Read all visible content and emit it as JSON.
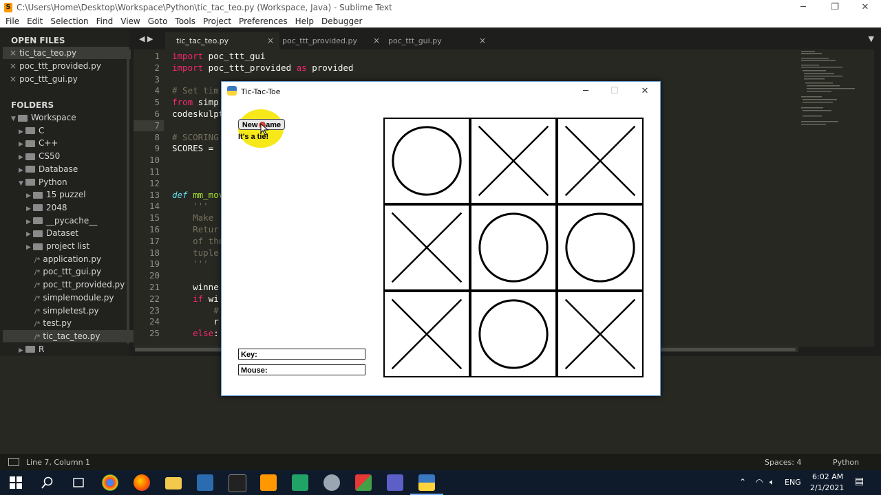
{
  "window": {
    "title": "C:\\Users\\Home\\Desktop\\Workspace\\Python\\tic_tac_teo.py (Workspace, Java) - Sublime Text"
  },
  "menu": [
    "File",
    "Edit",
    "Selection",
    "Find",
    "View",
    "Goto",
    "Tools",
    "Project",
    "Preferences",
    "Help",
    "Debugger"
  ],
  "sidebar": {
    "open_files_title": "OPEN FILES",
    "open_files": [
      "tic_tac_teo.py",
      "poc_ttt_provided.py",
      "poc_ttt_gui.py"
    ],
    "folders_title": "FOLDERS",
    "tree": [
      {
        "label": "Workspace",
        "depth": 0,
        "type": "folder-open"
      },
      {
        "label": "C",
        "depth": 1,
        "type": "folder"
      },
      {
        "label": "C++",
        "depth": 1,
        "type": "folder"
      },
      {
        "label": "CS50",
        "depth": 1,
        "type": "folder"
      },
      {
        "label": "Database",
        "depth": 1,
        "type": "folder"
      },
      {
        "label": "Python",
        "depth": 1,
        "type": "folder-open"
      },
      {
        "label": "15 puzzel",
        "depth": 2,
        "type": "folder"
      },
      {
        "label": "2048",
        "depth": 2,
        "type": "folder"
      },
      {
        "label": "__pycache__",
        "depth": 2,
        "type": "folder"
      },
      {
        "label": "Dataset",
        "depth": 2,
        "type": "folder"
      },
      {
        "label": "project list",
        "depth": 2,
        "type": "folder"
      },
      {
        "label": "application.py",
        "depth": 2,
        "type": "file"
      },
      {
        "label": "poc_ttt_gui.py",
        "depth": 2,
        "type": "file"
      },
      {
        "label": "poc_ttt_provided.py",
        "depth": 2,
        "type": "file"
      },
      {
        "label": "simplemodule.py",
        "depth": 2,
        "type": "file"
      },
      {
        "label": "simpletest.py",
        "depth": 2,
        "type": "file"
      },
      {
        "label": "test.py",
        "depth": 2,
        "type": "file"
      },
      {
        "label": "tic_tac_teo.py",
        "depth": 2,
        "type": "file",
        "active": true
      },
      {
        "label": "R",
        "depth": 1,
        "type": "folder"
      }
    ]
  },
  "tabs": [
    {
      "label": "tic_tac_teo.py",
      "active": true
    },
    {
      "label": "poc_ttt_provided.py",
      "active": false
    },
    {
      "label": "poc_ttt_gui.py",
      "active": false
    }
  ],
  "code_lines": [
    {
      "n": "1",
      "t": "import poc_ttt_gui"
    },
    {
      "n": "2",
      "t": "import poc_ttt_provided as provided"
    },
    {
      "n": "3",
      "t": ""
    },
    {
      "n": "4",
      "t": "# Set tim"
    },
    {
      "n": "5",
      "t": "from simp"
    },
    {
      "n": "6",
      "t": "codeskulpt"
    },
    {
      "n": "7",
      "t": ""
    },
    {
      "n": "8",
      "t": "# SCORING"
    },
    {
      "n": "9",
      "t": "SCORES = "
    },
    {
      "n": "10",
      "t": ""
    },
    {
      "n": "11",
      "t": ""
    },
    {
      "n": "12",
      "t": ""
    },
    {
      "n": "13",
      "t": "def mm_mov"
    },
    {
      "n": "14",
      "t": "    '''"
    },
    {
      "n": "15",
      "t": "    Make"
    },
    {
      "n": "16",
      "t": "    Retur"
    },
    {
      "n": "17",
      "t": "    of the"
    },
    {
      "n": "18",
      "t": "    tuple"
    },
    {
      "n": "19",
      "t": "    '''"
    },
    {
      "n": "20",
      "t": ""
    },
    {
      "n": "21",
      "t": "    winne"
    },
    {
      "n": "22",
      "t": "    if wi"
    },
    {
      "n": "23",
      "t": "        #"
    },
    {
      "n": "24",
      "t": "        r"
    },
    {
      "n": "25",
      "t": "    else:"
    }
  ],
  "statusbar": {
    "position": "Line 7, Column 1",
    "spaces": "Spaces: 4",
    "syntax": "Python"
  },
  "taskbar": {
    "time": "6:02 AM",
    "date": "2/1/2021",
    "lang": "ENG"
  },
  "game": {
    "title": "Tic-Tac-Toe",
    "new_game_label": "New Game",
    "status": "It's a tie!",
    "key_label": "Key:",
    "mouse_label": "Mouse:",
    "board": [
      [
        "O",
        "X",
        "X"
      ],
      [
        "X",
        "O",
        "O"
      ],
      [
        "X",
        "O",
        "X"
      ]
    ]
  }
}
